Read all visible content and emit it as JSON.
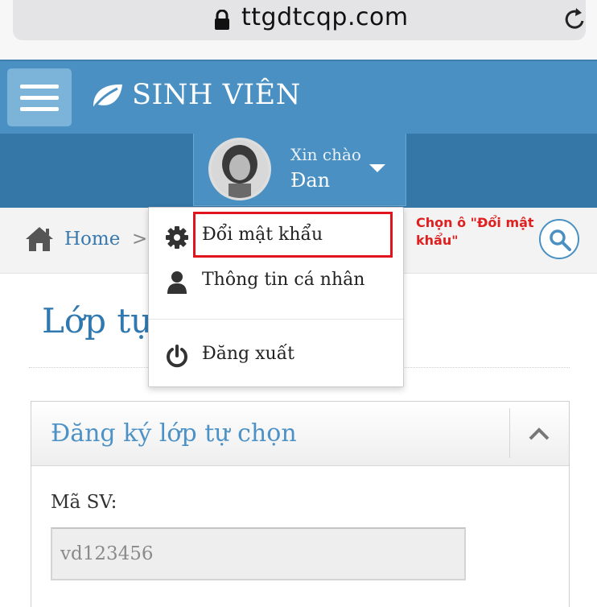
{
  "browser": {
    "url": "ttgdtcqp.com",
    "lock_icon": "lock-icon",
    "reload_icon": "reload-icon"
  },
  "header": {
    "menu_icon": "hamburger-menu-icon",
    "brand_icon": "leaf-icon",
    "brand_title": "SINH VIÊN"
  },
  "user_menu": {
    "greeting": "Xin chào",
    "username": "Đan",
    "caret_icon": "caret-down-icon"
  },
  "dropdown": {
    "items": [
      {
        "label": "Đổi mật khẩu",
        "icon": "gear-icon"
      },
      {
        "label": "Thông tin cá nhân",
        "icon": "user-icon"
      },
      {
        "label": "Đăng xuất",
        "icon": "power-icon"
      }
    ]
  },
  "breadcrumb": {
    "home_label": "Home",
    "separator": ">",
    "home_icon": "home-icon",
    "search_icon": "search-icon"
  },
  "annotation": {
    "text": "Chọn ô \"Đổi mật khẩu\"",
    "color": "#e02020"
  },
  "page": {
    "title": "Lớp tự"
  },
  "panel": {
    "title": "Đăng ký lớp tự chọn",
    "collapse_icon": "chevron-up-icon",
    "student_id_label": "Mã SV:",
    "student_id_value": "vd123456"
  },
  "colors": {
    "header_blue": "#4a90c2",
    "subheader_blue": "#3577a6",
    "link_blue": "#2f78b0",
    "highlight_red": "#e0141d"
  }
}
